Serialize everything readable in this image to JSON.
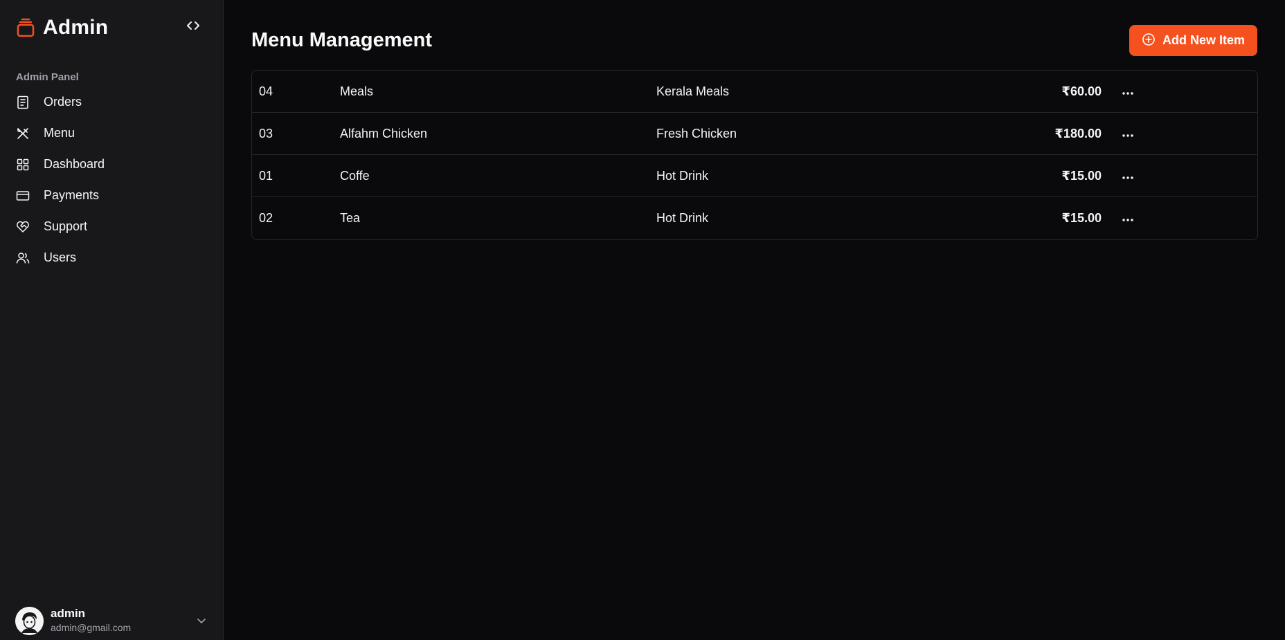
{
  "app": {
    "title": "Admin",
    "accent_color": "#f4511e"
  },
  "sidebar": {
    "section_label": "Admin Panel",
    "items": [
      {
        "label": "Orders",
        "icon": "receipt-icon"
      },
      {
        "label": "Menu",
        "icon": "utensils-icon"
      },
      {
        "label": "Dashboard",
        "icon": "grid-icon"
      },
      {
        "label": "Payments",
        "icon": "credit-card-icon"
      },
      {
        "label": "Support",
        "icon": "heart-handshake-icon"
      },
      {
        "label": "Users",
        "icon": "users-icon"
      }
    ],
    "user": {
      "name": "admin",
      "email": "admin@gmail.com"
    }
  },
  "main": {
    "title": "Menu Management",
    "add_button_label": "Add New Item",
    "rows": [
      {
        "id": "04",
        "name": "Meals",
        "description": "Kerala Meals",
        "price": "₹60.00"
      },
      {
        "id": "03",
        "name": "Alfahm Chicken",
        "description": "Fresh Chicken",
        "price": "₹180.00"
      },
      {
        "id": "01",
        "name": "Coffe",
        "description": "Hot Drink",
        "price": "₹15.00"
      },
      {
        "id": "02",
        "name": "Tea",
        "description": "Hot Drink",
        "price": "₹15.00"
      }
    ]
  }
}
